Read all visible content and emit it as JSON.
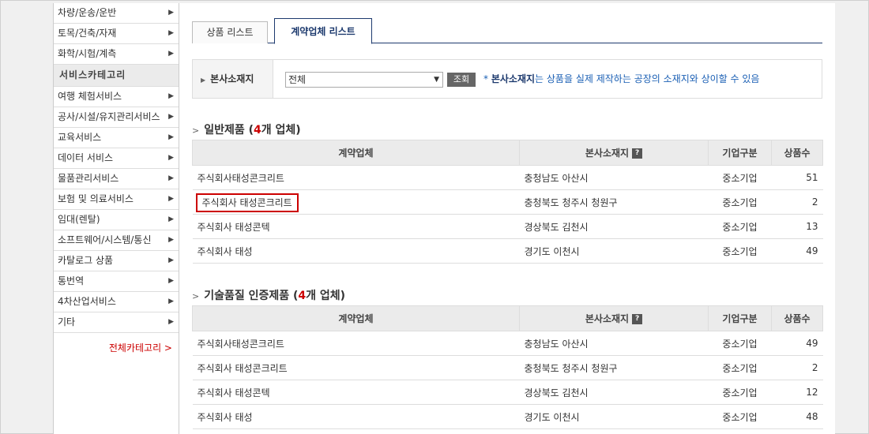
{
  "sidebar": {
    "top_items": [
      "차량/운송/운반",
      "토목/건축/자재",
      "화학/시험/계측"
    ],
    "service_heading": "서비스카테고리",
    "service_items": [
      "여행 체험서비스",
      "공사/시설/유지관리서비스",
      "교육서비스",
      "데이터 서비스",
      "물품관리서비스",
      "보험 및 의료서비스",
      "임대(렌탈)",
      "소프트웨어/시스템/통신",
      "카탈로그 상품",
      "통번역",
      "4차산업서비스",
      "기타"
    ],
    "all_categories": "전체카테고리 >"
  },
  "tabs": [
    {
      "label": "상품 리스트",
      "active": false
    },
    {
      "label": "계약업체 리스트",
      "active": true
    }
  ],
  "filter": {
    "label": "본사소재지",
    "select_value": "전체",
    "search_button": "조회",
    "note_prefix": "* ",
    "note_bold": "본사소재지",
    "note_rest": "는 상품을 실제 제작하는 공장의 소재지와 상이할 수 있음"
  },
  "general": {
    "title_prefix": "일반제품 (",
    "count": "4",
    "title_suffix": "개 업체)",
    "headers": [
      "계약업체",
      "본사소재지",
      "기업구분",
      "상품수"
    ],
    "rows": [
      {
        "company": "주식회사태성콘크리트",
        "location": "충청남도 아산시",
        "type": "중소기업",
        "count": "51"
      },
      {
        "company": "주식회사 태성콘크리트",
        "location": "충청북도 청주시 청원구",
        "type": "중소기업",
        "count": "2"
      },
      {
        "company": "주식회사 태성콘텍",
        "location": "경상북도 김천시",
        "type": "중소기업",
        "count": "13"
      },
      {
        "company": "주식회사 태성",
        "location": "경기도 이천시",
        "type": "중소기업",
        "count": "49"
      }
    ]
  },
  "certified": {
    "title_prefix": "기술품질 인증제품 (",
    "count": "4",
    "title_suffix": "개 업체)",
    "headers": [
      "계약업체",
      "본사소재지",
      "기업구분",
      "상품수"
    ],
    "rows": [
      {
        "company": "주식회사태성콘크리트",
        "location": "충청남도 아산시",
        "type": "중소기업",
        "count": "49"
      },
      {
        "company": "주식회사 태성콘크리트",
        "location": "충청북도 청주시 청원구",
        "type": "중소기업",
        "count": "2"
      },
      {
        "company": "주식회사 태성콘텍",
        "location": "경상북도 김천시",
        "type": "중소기업",
        "count": "12"
      },
      {
        "company": "주식회사 태성",
        "location": "경기도 이천시",
        "type": "중소기업",
        "count": "48"
      }
    ]
  },
  "icons": {
    "arrow": "triangle-right-icon",
    "help": "question-mark-icon"
  },
  "colors": {
    "accent": "#1d3a6e",
    "highlight": "#cc0000",
    "note": "#1a5fb4"
  }
}
